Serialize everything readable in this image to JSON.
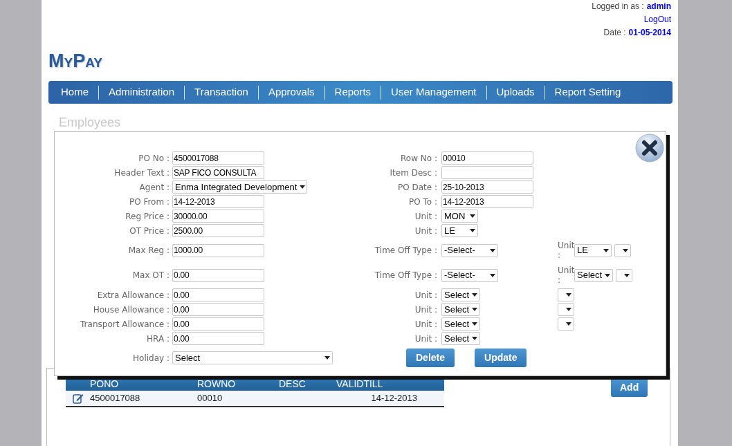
{
  "header": {
    "logged_in_label": "Logged in as :",
    "user": "admin",
    "logout": "LogOut",
    "date_label": "Date :",
    "date": "01-05-2014"
  },
  "logo": "MyPay",
  "nav": [
    {
      "label": "Home"
    },
    {
      "label": "Administration"
    },
    {
      "label": "Transaction"
    },
    {
      "label": "Approvals"
    },
    {
      "label": "Reports"
    },
    {
      "label": "User Management"
    },
    {
      "label": "Uploads"
    },
    {
      "label": "Report Setting"
    }
  ],
  "page_title": "Employees",
  "table": {
    "columns": [
      "PONO",
      "ROWNO",
      "DESC",
      "VALIDTILL"
    ],
    "rows": [
      {
        "pono": "4500017088",
        "rowno": "00010",
        "validtill": "14-12-2013"
      }
    ]
  },
  "add_button": "Add",
  "dialog": {
    "rows": [
      {
        "left": {
          "label": "PO No :",
          "kind": "input",
          "value": "4500017088"
        },
        "right": {
          "label": "Row No :",
          "kind": "input",
          "value": "00010"
        }
      },
      {
        "left": {
          "label": "Header Text :",
          "kind": "input",
          "value": "SAP FICO CONSULTA"
        },
        "right": {
          "label": "Item Desc :",
          "kind": "input"
        }
      },
      {
        "left": {
          "label": "Agent :",
          "kind": "select",
          "value": "Enma Integrated Development"
        },
        "right": {
          "label": "PO Date :",
          "kind": "input",
          "value": "25-10-2013"
        }
      },
      {
        "left": {
          "label": "PO From :",
          "kind": "input",
          "value": "14-12-2013"
        },
        "right": {
          "label": "PO To :",
          "kind": "input",
          "value": "14-12-2013"
        }
      },
      {
        "left": {
          "label": "Reg Price :",
          "kind": "input",
          "value": "30000.00"
        },
        "right": {
          "label": "Unit :",
          "kind": "unit",
          "value": "MON"
        }
      },
      {
        "left": {
          "label": "OT Price :",
          "kind": "input",
          "value": "2500.00"
        },
        "right": {
          "label": "Unit :",
          "kind": "unit",
          "value": "LE"
        }
      },
      {
        "left": {
          "label": "Max Reg :",
          "kind": "input",
          "value": "1000.00"
        },
        "right": {
          "label": "Time Off Type :",
          "kind": "type",
          "value": "-Select-"
        },
        "extras": [
          {
            "kind": "labeled-unit",
            "label": "Unit :",
            "value": "LE"
          },
          {
            "kind": "blank-select"
          }
        ]
      },
      {
        "left": {
          "label": "Max OT :",
          "kind": "input",
          "value": "0.00"
        },
        "right": {
          "label": "Time Off Type :",
          "kind": "type",
          "value": "-Select-"
        },
        "extras": [
          {
            "kind": "labeled-unit",
            "label": "Unit :",
            "value": "Select"
          },
          {
            "kind": "blank-select"
          }
        ]
      },
      {
        "left": {
          "label": "Extra Allowance :",
          "kind": "input",
          "value": "0.00"
        },
        "right": {
          "label": "Unit :",
          "kind": "unit",
          "value": "Select"
        },
        "extras": [
          {
            "kind": "blank-select"
          }
        ]
      },
      {
        "left": {
          "label": "House Allowance :",
          "kind": "input",
          "value": "0.00"
        },
        "right": {
          "label": "Unit :",
          "kind": "unit",
          "value": "Select"
        },
        "extras": [
          {
            "kind": "blank-select"
          }
        ]
      },
      {
        "left": {
          "label": "Transport Allowance :",
          "kind": "input",
          "value": "0.00"
        },
        "right": {
          "label": "Unit :",
          "kind": "unit",
          "value": "Select"
        },
        "extras": [
          {
            "kind": "blank-select"
          }
        ]
      },
      {
        "left": {
          "label": "HRA :",
          "kind": "input",
          "value": "0.00"
        },
        "right": {
          "label": "Unit :",
          "kind": "unit",
          "value": "Select"
        }
      }
    ],
    "holiday": {
      "label": "Holiday :",
      "value": "Select"
    },
    "buttons": [
      "Delete",
      "Update"
    ]
  }
}
